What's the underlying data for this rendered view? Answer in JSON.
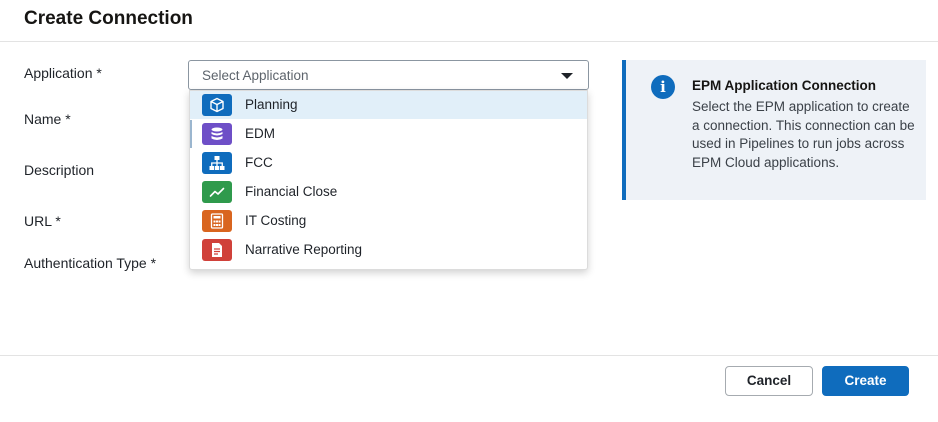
{
  "dialog": {
    "title": "Create Connection"
  },
  "form": {
    "application_label": "Application *",
    "name_label": "Name *",
    "description_label": "Description",
    "url_label": "URL *",
    "auth_label": "Authentication Type *",
    "application_select": {
      "placeholder": "Select Application"
    }
  },
  "dropdown": {
    "options": [
      {
        "label": "Planning",
        "icon": "cube-icon",
        "color": "#0f6cbd",
        "highlighted": true
      },
      {
        "label": "EDM",
        "icon": "database-icon",
        "color": "#6e4fc7"
      },
      {
        "label": "FCC",
        "icon": "hierarchy-icon",
        "color": "#0f6cbd"
      },
      {
        "label": "Financial Close",
        "icon": "trend-chart-icon",
        "color": "#2f9a4c"
      },
      {
        "label": "IT Costing",
        "icon": "calculator-icon",
        "color": "#d9651f"
      },
      {
        "label": "Narrative Reporting",
        "icon": "report-icon",
        "color": "#d0413a"
      }
    ]
  },
  "info": {
    "title": "EPM Application Connection",
    "body": "Select the EPM application to create a connection. This connection can be used in Pipelines to run jobs across EPM Cloud applications.",
    "icon": "info-icon",
    "accent": "#0f6cbd"
  },
  "footer": {
    "cancel_label": "Cancel",
    "create_label": "Create"
  }
}
